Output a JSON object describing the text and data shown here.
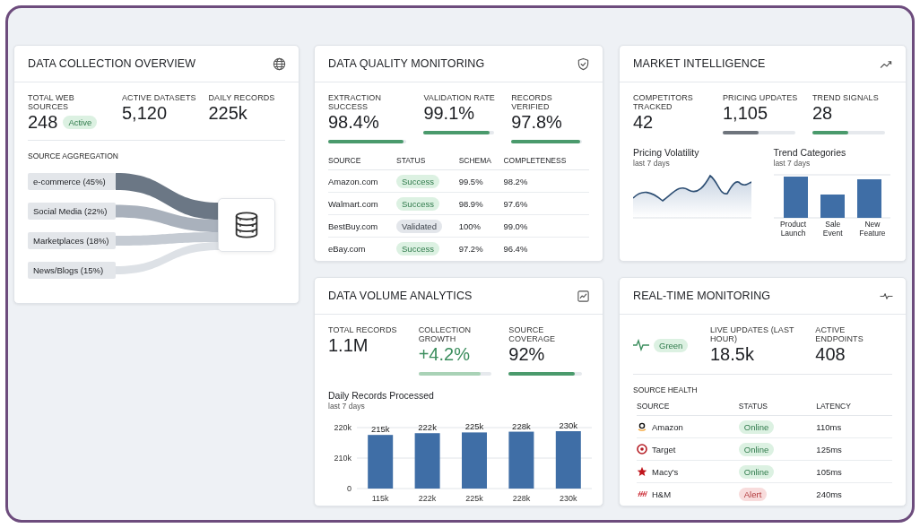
{
  "data_collection": {
    "title": "DATA COLLECTION OVERVIEW",
    "metrics": [
      {
        "label": "TOTAL WEB SOURCES",
        "value": "248",
        "badge": "Active"
      },
      {
        "label": "ACTIVE DATASETS",
        "value": "5,120"
      },
      {
        "label": "DAILY RECORDS",
        "value": "225k"
      }
    ],
    "section": "SOURCE AGGREGATION",
    "sources": [
      "e-commerce (45%)",
      "Social Media (22%)",
      "Marketplaces (18%)",
      "News/Blogs (15%)"
    ]
  },
  "data_quality": {
    "title": "DATA QUALITY MONITORING",
    "metrics": [
      {
        "label": "EXTRACTION SUCCESS",
        "value": "98.4%",
        "level": 0.97,
        "color": "#4a9a6c"
      },
      {
        "label": "VALIDATION RATE",
        "value": "99.1%",
        "level": 0.93,
        "color": "#4a9a6c"
      },
      {
        "label": "RECORDS VERIFIED",
        "value": "97.8%",
        "level": 0.97,
        "color": "#4a9a6c"
      }
    ],
    "columns": [
      "SOURCE",
      "STATUS",
      "SCHEMA",
      "COMPLETENESS"
    ],
    "rows": [
      {
        "source": "Amazon.com",
        "status": "Success",
        "kind": "success",
        "schema": "99.5%",
        "completeness": "98.2%"
      },
      {
        "source": "Walmart.com",
        "status": "Success",
        "kind": "success",
        "schema": "98.9%",
        "completeness": "97.6%"
      },
      {
        "source": "BestBuy.com",
        "status": "Validated",
        "kind": "neutral",
        "schema": "100%",
        "completeness": "99.0%"
      },
      {
        "source": "eBay.com",
        "status": "Success",
        "kind": "success",
        "schema": "97.2%",
        "completeness": "96.4%"
      }
    ]
  },
  "market_intelligence": {
    "title": "MARKET INTELLIGENCE",
    "metrics": [
      {
        "label": "COMPETITORS TRACKED",
        "value": "42"
      },
      {
        "label": "PRICING UPDATES",
        "value": "1,105",
        "level": 0.5,
        "color": "#6e747c"
      },
      {
        "label": "TREND SIGNALS",
        "value": "28",
        "level": 0.5,
        "color": "#4a9a6c"
      }
    ],
    "volatility": {
      "title": "Pricing Volatility",
      "subtitle": "last 7 days"
    },
    "trends": {
      "title": "Trend Categories",
      "subtitle": "last 7 days",
      "categories": [
        "Product Launch",
        "Sale Event",
        "New Feature"
      ]
    }
  },
  "data_volume": {
    "title": "DATA VOLUME ANALYTICS",
    "metrics": [
      {
        "label": "TOTAL RECORDS",
        "value": "1.1M"
      },
      {
        "label": "COLLECTION GROWTH",
        "value": "+4.2%",
        "positive": true,
        "level": 0.85,
        "color": "#a9d2b6"
      },
      {
        "label": "SOURCE COVERAGE",
        "value": "92%",
        "level": 0.9,
        "color": "#4a9a6c"
      }
    ],
    "chart_title": "Daily Records Processed",
    "chart_subtitle": "last 7 days",
    "chart_data": {
      "type": "bar",
      "categories": [
        "115k",
        "222k",
        "225k",
        "228k",
        "230k"
      ],
      "values": [
        215000,
        222000,
        225000,
        228000,
        230000
      ],
      "value_labels": [
        "215k",
        "222k",
        "225k",
        "228k",
        "230k"
      ]
    },
    "axis_labels": [
      "220k",
      "210k",
      "0"
    ]
  },
  "realtime": {
    "title": "REAL-TIME MONITORING",
    "status": "Green",
    "metrics": [
      {
        "label": "LIVE UPDATES (LAST HOUR)",
        "value": "18.5k"
      },
      {
        "label": "ACTIVE ENDPOINTS",
        "value": "408"
      }
    ],
    "section": "SOURCE HEALTH",
    "columns": [
      "SOURCE",
      "STATUS",
      "LATENCY"
    ],
    "rows": [
      {
        "source": "Amazon",
        "status": "Online",
        "kind": "success",
        "latency": "110ms"
      },
      {
        "source": "Target",
        "status": "Online",
        "kind": "success",
        "latency": "125ms"
      },
      {
        "source": "Macy's",
        "status": "Online",
        "kind": "success",
        "latency": "105ms"
      },
      {
        "source": "H&M",
        "status": "Alert",
        "kind": "alert",
        "latency": "240ms"
      }
    ]
  }
}
